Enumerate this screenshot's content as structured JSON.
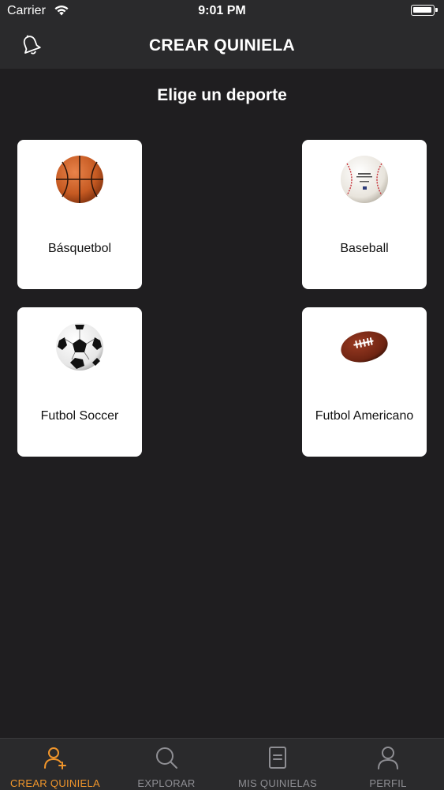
{
  "status_bar": {
    "carrier": "Carrier",
    "time": "9:01 PM"
  },
  "nav": {
    "title": "CREAR QUINIELA",
    "left_icon": "bell-icon"
  },
  "main": {
    "subtitle": "Elige un deporte",
    "sports": [
      {
        "label": "Básquetbol",
        "icon": "basketball-icon"
      },
      {
        "label": "Baseball",
        "icon": "baseball-icon"
      },
      {
        "label": "Futbol Soccer",
        "icon": "soccer-ball-icon"
      },
      {
        "label": "Futbol Americano",
        "icon": "american-football-icon"
      }
    ]
  },
  "tab_bar": {
    "active_color": "#f0952b",
    "inactive_color": "#8e8e93",
    "tabs": [
      {
        "label": "CREAR QUINIELA",
        "icon": "add-user-icon",
        "active": true
      },
      {
        "label": "EXPLORAR",
        "icon": "search-icon",
        "active": false
      },
      {
        "label": "MIS QUINIELAS",
        "icon": "document-icon",
        "active": false
      },
      {
        "label": "PERFIL",
        "icon": "user-icon",
        "active": false
      }
    ]
  },
  "colors": {
    "background": "#1f1e20",
    "bar": "#2a2a2c",
    "card": "#ffffff"
  }
}
